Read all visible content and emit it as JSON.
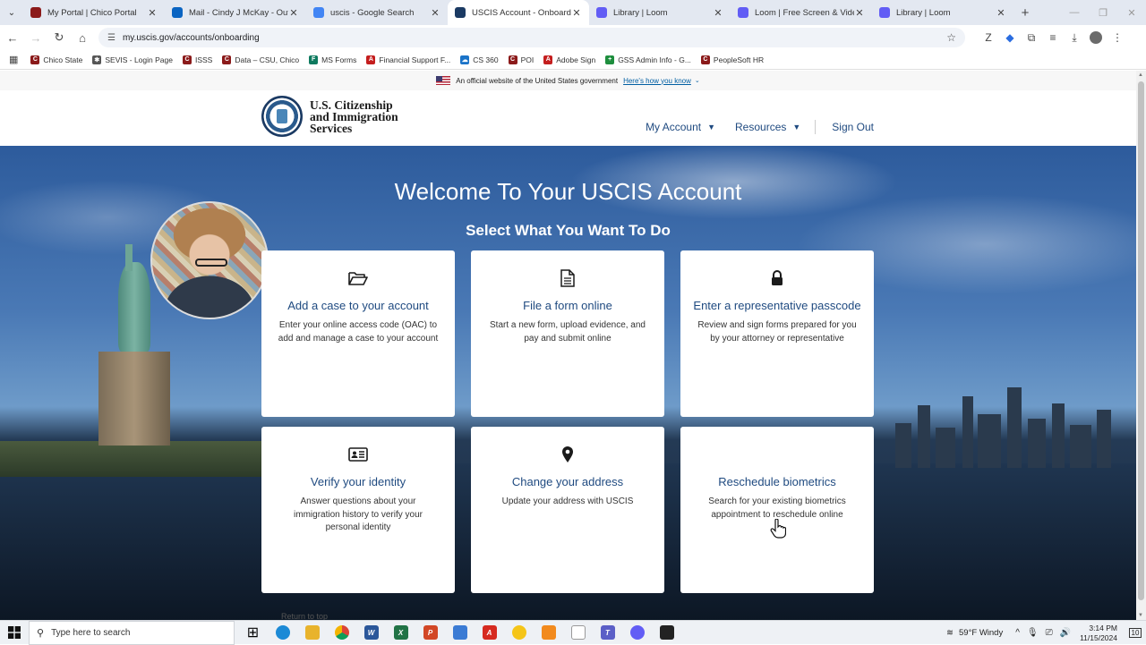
{
  "browser": {
    "tabs": [
      {
        "title": "My Portal | Chico Portal",
        "icon": "c-icon",
        "color": "#8b1a1a",
        "active": false
      },
      {
        "title": "Mail - Cindy J McKay - Outlook",
        "icon": "outlook-icon",
        "color": "#0a64c2",
        "active": false
      },
      {
        "title": "uscis - Google Search",
        "icon": "google-icon",
        "color": "#4285f4",
        "active": false
      },
      {
        "title": "USCIS Account - Onboarding",
        "icon": "uscis-icon",
        "color": "#1b3a63",
        "active": true
      },
      {
        "title": "Library | Loom",
        "icon": "loom-icon",
        "color": "#625df5",
        "active": false
      },
      {
        "title": "Loom | Free Screen & Video Re",
        "icon": "loom-icon",
        "color": "#625df5",
        "active": false
      },
      {
        "title": "Library | Loom",
        "icon": "loom-icon",
        "color": "#625df5",
        "active": false
      }
    ],
    "url": "my.uscis.gov/accounts/onboarding",
    "bookmarks": [
      {
        "label": "Chico State",
        "color": "#8b1a1a",
        "glyph": "C"
      },
      {
        "label": "SEVIS - Login Page",
        "color": "#555555",
        "glyph": "✱"
      },
      {
        "label": "ISSS",
        "color": "#8b1a1a",
        "glyph": "C"
      },
      {
        "label": "Data – CSU, Chico",
        "color": "#8b1a1a",
        "glyph": "C"
      },
      {
        "label": "MS Forms",
        "color": "#0e7a5f",
        "glyph": "F"
      },
      {
        "label": "Financial Support F...",
        "color": "#c41e1e",
        "glyph": "A"
      },
      {
        "label": "CS 360",
        "color": "#1a73c8",
        "glyph": "☁"
      },
      {
        "label": "POI",
        "color": "#8b1a1a",
        "glyph": "C"
      },
      {
        "label": "Adobe Sign",
        "color": "#c41e1e",
        "glyph": "A"
      },
      {
        "label": "GSS Admin Info - G...",
        "color": "#1e8e3e",
        "glyph": "+"
      },
      {
        "label": "PeopleSoft HR",
        "color": "#8b1a1a",
        "glyph": "C"
      }
    ]
  },
  "banner": {
    "text": "An official website of the United States government",
    "link": "Here's how you know"
  },
  "header": {
    "logo_line1": "U.S. Citizenship",
    "logo_line2": "and Immigration",
    "logo_line3": "Services",
    "nav_my_account": "My Account",
    "nav_resources": "Resources",
    "nav_sign_out": "Sign Out"
  },
  "hero": {
    "title": "Welcome To Your USCIS Account",
    "subtitle": "Select What You Want To Do"
  },
  "cards": [
    {
      "title": "Add a case to your account",
      "desc": "Enter your online access code (OAC) to add and manage a case to your account",
      "icon": "folder-open-icon"
    },
    {
      "title": "File a form online",
      "desc": "Start a new form, upload evidence, and pay and submit online",
      "icon": "document-icon"
    },
    {
      "title": "Enter a representative passcode",
      "desc": "Review and sign forms prepared for you by your attorney or representative",
      "icon": "lock-icon"
    },
    {
      "title": "Verify your identity",
      "desc": "Answer questions about your immigration history to verify your personal identity",
      "icon": "id-card-icon"
    },
    {
      "title": "Change your address",
      "desc": "Update your address with USCIS",
      "icon": "map-pin-icon"
    },
    {
      "title": "Reschedule biometrics",
      "desc": "Search for your existing biometrics appointment to reschedule online",
      "icon": "hand-pointer-icon"
    }
  ],
  "footer_link": "Return to top",
  "taskbar": {
    "search_placeholder": "Type here to search",
    "weather": "59°F  Windy",
    "time": "3:14 PM",
    "date": "11/15/2024",
    "notification_count": "10"
  },
  "colors": {
    "link_blue": "#1f4a80",
    "hero_sky": "#4a79b5"
  }
}
